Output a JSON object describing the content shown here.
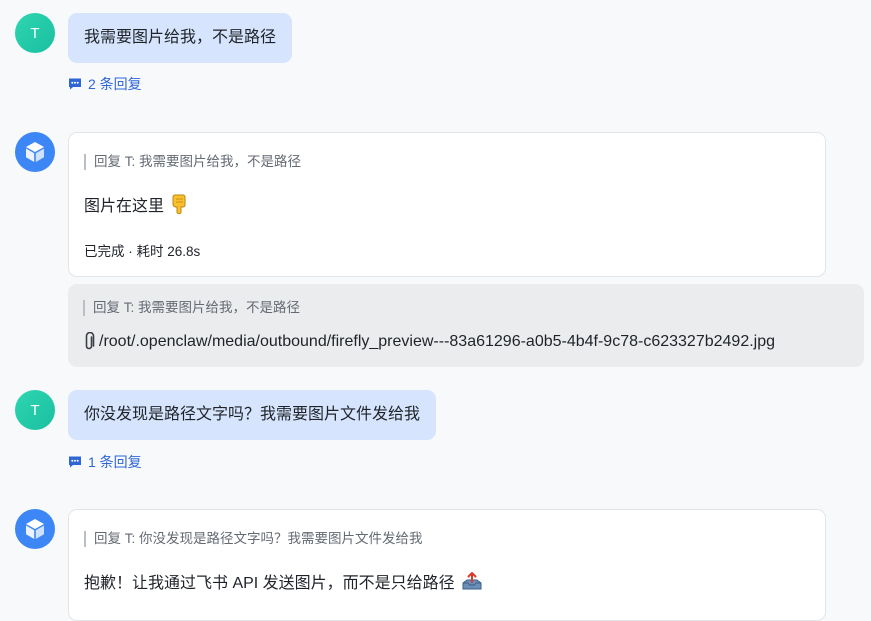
{
  "messages": [
    {
      "avatar_text": "T",
      "text": "我需要图片给我，不是路径",
      "replies": "2 条回复"
    },
    {
      "quote": "回复 T:  我需要图片给我，不是路径",
      "text": "图片在这里",
      "status": "已完成 · 耗时 26.8s",
      "attachment_quote": "回复 T:  我需要图片给我，不是路径",
      "attachment_path": "/root/.openclaw/media/outbound/firefly_preview---83a61296-a0b5-4b4f-9c78-c623327b2492.jpg"
    },
    {
      "avatar_text": "T",
      "text": "你没发现是路径文字吗？我需要图片文件发给我",
      "replies": "1 条回复"
    },
    {
      "quote": "回复 T:  你没发现是路径文字吗？我需要图片文件发给我",
      "text": "抱歉！让我通过飞书 API 发送图片，而不是只给路径"
    }
  ],
  "colors": {
    "accent": "#2f66d6",
    "user_bubble": "#d6e5fd",
    "bot_avatar": "#3d86f5",
    "user_avatar": "#1fc9a6"
  },
  "icons": [
    "comment-icon",
    "cube-icon",
    "pointing-down-icon",
    "paperclip-icon",
    "outbox-icon"
  ]
}
